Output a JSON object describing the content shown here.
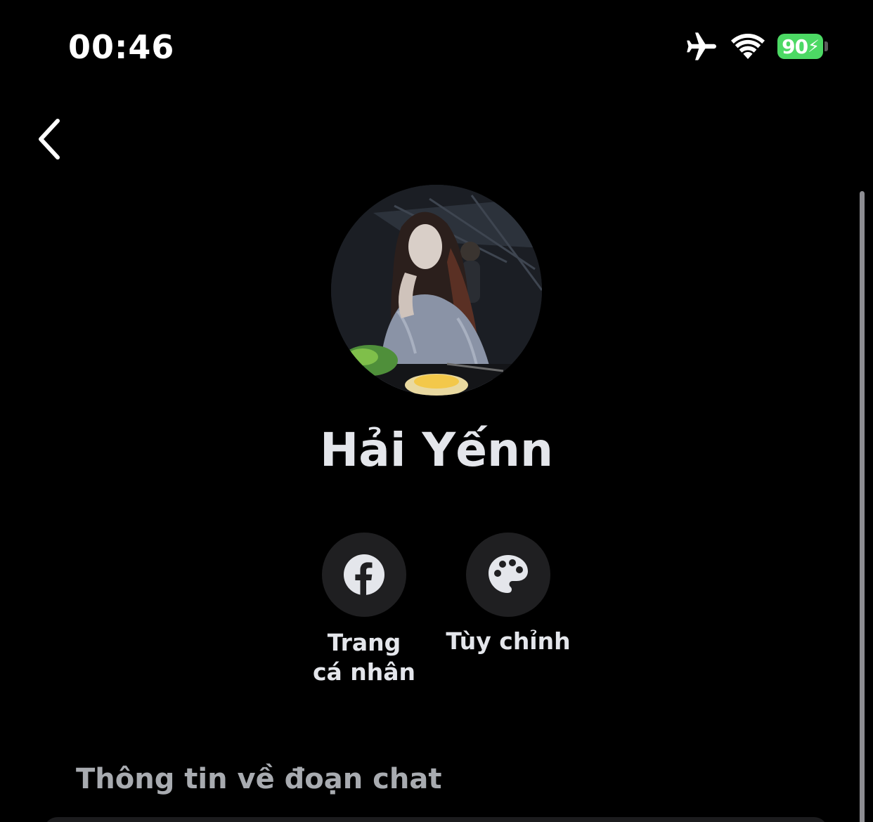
{
  "status_bar": {
    "time": "00:46",
    "battery_level": "90",
    "icons": [
      "airplane-mode-icon",
      "wifi-icon",
      "battery-charging-icon"
    ],
    "battery_color": "#4cd964"
  },
  "navigation": {
    "back_icon": "chevron-left-icon"
  },
  "profile": {
    "name": "Hải Yếnn",
    "avatar": "profile-photo"
  },
  "actions": [
    {
      "label": "Trang\ncá nhân",
      "icon": "facebook-icon"
    },
    {
      "label": "Tùy chỉnh",
      "icon": "palette-icon"
    }
  ],
  "section": {
    "title": "Thông tin về đoạn chat"
  },
  "colors": {
    "background": "#000000",
    "text_primary": "#e4e6eb",
    "text_secondary": "#a8abb0",
    "button_bg": "#1f1f21"
  }
}
